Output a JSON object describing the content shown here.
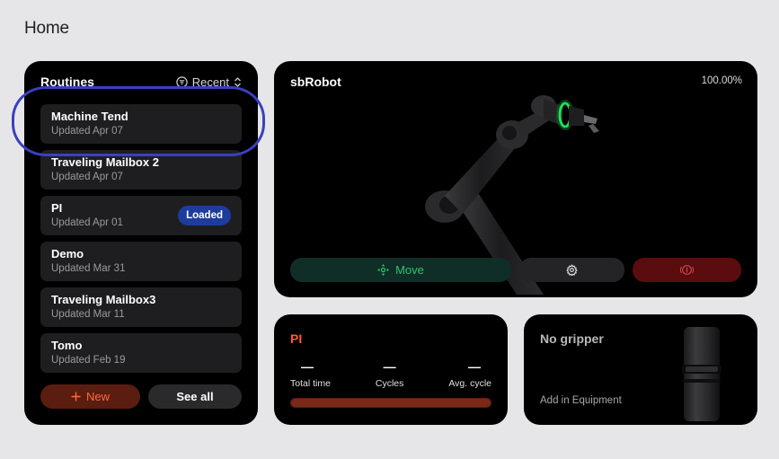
{
  "page": {
    "title": "Home"
  },
  "routines": {
    "title": "Routines",
    "sort_label": "Recent",
    "items": [
      {
        "name": "Machine Tend",
        "updated": "Updated Apr 07",
        "badge": ""
      },
      {
        "name": "Traveling Mailbox 2",
        "updated": "Updated Apr 07",
        "badge": ""
      },
      {
        "name": "PI",
        "updated": "Updated Apr 01",
        "badge": "Loaded"
      },
      {
        "name": "Demo",
        "updated": "Updated Mar 31",
        "badge": ""
      },
      {
        "name": "Traveling Mailbox3",
        "updated": "Updated Mar 11",
        "badge": ""
      },
      {
        "name": "Tomo",
        "updated": "Updated Feb 19",
        "badge": ""
      }
    ],
    "new_label": "New",
    "new_icon": "plus-icon",
    "see_all_label": "See all"
  },
  "robot": {
    "name": "sbRobot",
    "status_percent": "100.00%",
    "move_label": "Move",
    "move_icon": "move-arrows-icon",
    "settings_icon": "gear-icon",
    "estop_icon": "emergency-stop-icon",
    "accent_green": "#2fc36e",
    "light_ring_color": "#1fe05a"
  },
  "stats": {
    "routine_name": "PI",
    "total_time_value": "—",
    "total_time_label": "Total time",
    "cycles_value": "—",
    "cycles_label": "Cycles",
    "avg_cycle_value": "—",
    "avg_cycle_label": "Avg. cycle",
    "progress_fraction": 1.0
  },
  "gripper": {
    "title": "No gripper",
    "subtitle": "Add in Equipment"
  },
  "colors": {
    "accent_orange": "#ff5a2a",
    "badge_blue": "#1d3c9c",
    "highlight": "#3b3fc0",
    "estop_red": "#5a0c0e"
  }
}
